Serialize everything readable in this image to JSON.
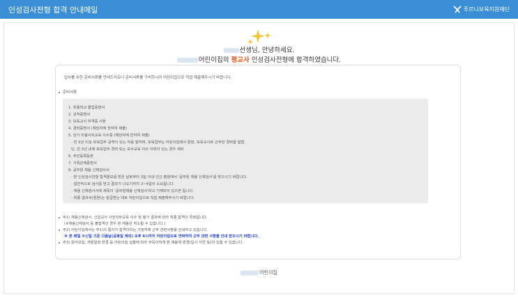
{
  "window": {
    "title": "인성검사전형 합격 안내메일",
    "logo_text": "푸르니보육지원재단"
  },
  "greeting": {
    "line1_suffix": "선생님, 안녕하세요.",
    "line2_prefix": "어린이집의 ",
    "line2_accent": "평교사",
    "line2_suffix": " 인성검사전형에 합격하였습니다."
  },
  "content": {
    "intro": "입사를 위한 준비서류를 안내드리오니 준비서류를 구비하시어 어린이집으로 직접 제출해주시기 바랍니다.",
    "section_title": "준비서류",
    "documents": [
      "1. 최종학교 졸업증명서",
      "2. 성적증명서",
      "3. 보육교사 자격증 사본",
      "4. 경력증명서 (해당자에 한하여 제출)",
      "5. 당기 미충사자교육 이수증 (해당자에 한하여 제출)",
      "  - 만 2년 이상 보육업무 공백이 있는 자를 말하며, 보육업무는 어린이집에서 원장, 보육교사로 근무한 경력을 말함.",
      "  단, 만 2년 내에 보육업무 경력 또는 보수교육 이수 이력이 있는 경우 제외",
      "6. 주민등록등본",
      "7. 가족관계증명서",
      "8. 공무원 채용 신체검사서",
      "  - 본 인성검사전형 합격통보를 받은 날로부터 3일 이내 인근 병원에서 '공무원 채용 신체검사'를 받으시기 바랍니다.",
      "  - 일반적으로 검사를 받고 결과가 나오기까지 3~4일이 소요됩니다.",
      "  - 채용 신체검사서에 제목이 '공무원채용 신체검사'라고 기재되어 있으면 됩니다.",
      "  - 최종 결과서(원본)는 발급받는 대로 어린이집으로 직접 제출해주시기 바랍니다."
    ],
    "notes": [
      {
        "text": "주1) 채용신체검사, 신입교사 사전직무교육 이수 및 평가 결과에 따라 최종 합격이 확정됩니다.",
        "bullet": true,
        "blue": false
      },
      {
        "text": "(※채용신체검사 등 불합격인 경우 본 채용은 취소될 수 있습니다.)",
        "bullet": false,
        "blue": false
      },
      {
        "text": "주2) 어린이집에서는 주1)의 절차가 합격이라는 가정하에 근무 관련사항을 안내하고 있습니다.",
        "bullet": true,
        "blue": false
      },
      {
        "text": "※ 본 메일 수신일 기준 다음날(공휴일 제외) 오후 6시까지 어린이집으로 연락하여 근무 관련 사항을 안내 받으시기 바랍니다.",
        "bullet": false,
        "blue": true
      },
      {
        "text": "주3) 원아모집, 개원일정 변경 등 어린이집 상황에 따라 부득이하게 본 채용에 변경(입사 지연 등)이 있을 수 있습니다.",
        "bullet": true,
        "blue": false
      }
    ]
  },
  "footer": {
    "suffix": "어린이집"
  },
  "colors": {
    "titlebar": "#3a8ed6",
    "accent": "#e05a1e",
    "notice_blue": "#1f3fd0",
    "gray_box": "#ebebeb",
    "sparkle": "#f2c230"
  }
}
